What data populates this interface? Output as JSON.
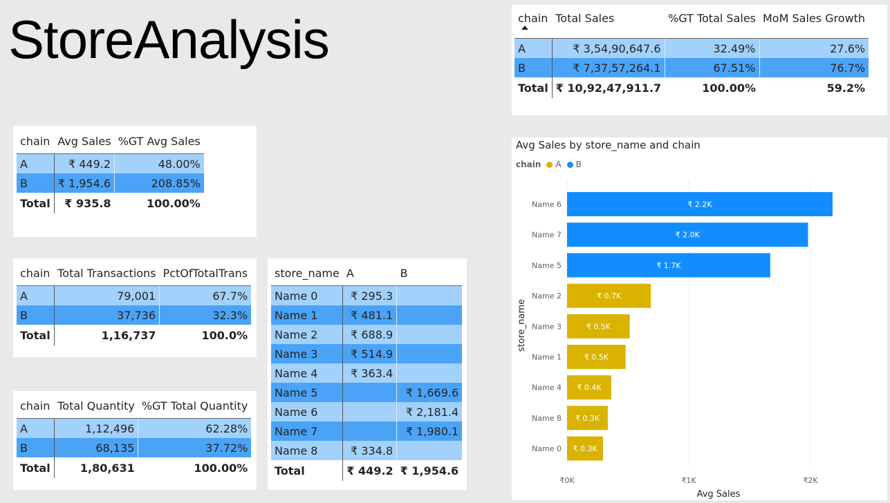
{
  "page": {
    "title": "StoreAnalysis"
  },
  "colors": {
    "chain_a": "#d9b300",
    "chain_b": "#118dff",
    "row_a": "#a2d1fc",
    "row_b": "#4aa3f7"
  },
  "table_sales": {
    "headers": [
      "chain",
      "Total Sales",
      "%GT Total Sales",
      "MoM Sales Growth"
    ],
    "rows": [
      [
        "A",
        "₹ 3,54,90,647.6",
        "32.49%",
        "27.6%"
      ],
      [
        "B",
        "₹ 7,37,57,264.1",
        "67.51%",
        "76.7%"
      ]
    ],
    "total": [
      "Total",
      "₹ 10,92,47,911.7",
      "100.00%",
      "59.2%"
    ]
  },
  "table_avg": {
    "headers": [
      "chain",
      "Avg Sales",
      "%GT Avg Sales"
    ],
    "rows": [
      [
        "A",
        "₹ 449.2",
        "48.00%"
      ],
      [
        "B",
        "₹ 1,954.6",
        "208.85%"
      ]
    ],
    "total": [
      "Total",
      "₹ 935.8",
      "100.00%"
    ]
  },
  "table_trans": {
    "headers": [
      "chain",
      "Total Transactions",
      "PctOfTotalTrans"
    ],
    "rows": [
      [
        "A",
        "79,001",
        "67.7%"
      ],
      [
        "B",
        "37,736",
        "32.3%"
      ]
    ],
    "total": [
      "Total",
      "1,16,737",
      "100.0%"
    ]
  },
  "table_qty": {
    "headers": [
      "chain",
      "Total Quantity",
      "%GT Total Quantity"
    ],
    "rows": [
      [
        "A",
        "1,12,496",
        "62.28%"
      ],
      [
        "B",
        "68,135",
        "37.72%"
      ]
    ],
    "total": [
      "Total",
      "1,80,631",
      "100.00%"
    ]
  },
  "table_store": {
    "headers": [
      "store_name",
      "A",
      "B"
    ],
    "rows": [
      [
        "Name 0",
        "₹ 295.3",
        ""
      ],
      [
        "Name 1",
        "₹ 481.1",
        ""
      ],
      [
        "Name 2",
        "₹ 688.9",
        ""
      ],
      [
        "Name 3",
        "₹ 514.9",
        ""
      ],
      [
        "Name 4",
        "₹ 363.4",
        ""
      ],
      [
        "Name 5",
        "",
        "₹ 1,669.6"
      ],
      [
        "Name 6",
        "",
        "₹ 2,181.4"
      ],
      [
        "Name 7",
        "",
        "₹ 1,980.1"
      ],
      [
        "Name 8",
        "₹ 334.8",
        ""
      ]
    ],
    "total": [
      "Total",
      "₹ 449.2",
      "₹ 1,954.6"
    ]
  },
  "chart_data": {
    "type": "bar",
    "orientation": "horizontal",
    "title": "Avg Sales by store_name and chain",
    "legend_title": "chain",
    "legend": [
      "A",
      "B"
    ],
    "legend_placement": "top-left",
    "xlabel": "Avg Sales",
    "ylabel": "store_name",
    "xlim": [
      0,
      2400
    ],
    "xticks": [
      0,
      1000,
      2000
    ],
    "xtick_labels": [
      "₹0K",
      "₹1K",
      "₹2K"
    ],
    "grid": true,
    "categories": [
      "Name 6",
      "Name 7",
      "Name 5",
      "Name 2",
      "Name 3",
      "Name 1",
      "Name 4",
      "Name 8",
      "Name 0"
    ],
    "values": [
      2181.4,
      1980.1,
      1669.6,
      688.9,
      514.9,
      481.1,
      363.4,
      334.8,
      295.3
    ],
    "chain": [
      "B",
      "B",
      "B",
      "A",
      "A",
      "A",
      "A",
      "A",
      "A"
    ],
    "data_labels": [
      "₹ 2.2K",
      "₹ 2.0K",
      "₹ 1.7K",
      "₹ 0.7K",
      "₹ 0.5K",
      "₹ 0.5K",
      "₹ 0.4K",
      "₹ 0.3K",
      "₹ 0.3K"
    ]
  }
}
